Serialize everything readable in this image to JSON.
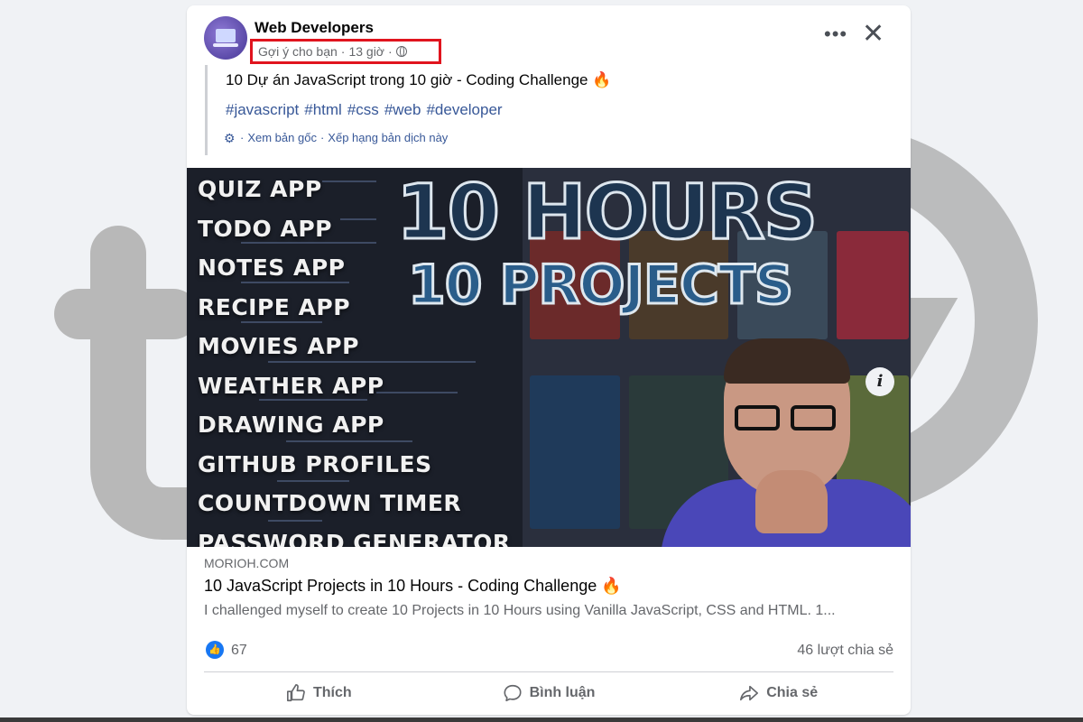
{
  "post": {
    "page_name": "Web Developers",
    "suggested": "Gợi ý cho bạn",
    "sep1": "·",
    "time": "13 giờ",
    "sep2": "·",
    "text": "10 Dự án JavaScript trong 10 giờ - Coding Challenge 🔥",
    "hashtags": [
      "#javascript",
      "#html",
      "#css",
      "#web",
      "#developer"
    ],
    "translate_sep": "·",
    "see_original": "Xem bản gốc",
    "sep3": "·",
    "rate_translation": "Xếp hạng bản dịch này"
  },
  "thumbnail": {
    "apps": [
      "QUIZ APP",
      "TODO APP",
      "NOTES APP",
      "RECIPE APP",
      "MOVIES APP",
      "WEATHER APP",
      "DRAWING APP",
      "GITHUB PROFILES",
      "COUNTDOWN TIMER",
      "PASSWORD GENERATOR"
    ],
    "headline_1": "10 HOURS",
    "headline_2": "10 PROJECTS"
  },
  "link": {
    "domain": "MORIOH.COM",
    "title": "10 JavaScript Projects in 10 Hours - Coding Challenge 🔥",
    "description": "I challenged myself to create 10 Projects in 10 Hours using Vanilla JavaScript, CSS and HTML. 1..."
  },
  "stats": {
    "likes": "67",
    "shares": "46 lượt chia sẻ"
  },
  "actions": {
    "like": "Thích",
    "comment": "Bình luận",
    "share": "Chia sẻ"
  },
  "icons": {
    "more": "more-dots-icon",
    "close": "close-icon",
    "globe": "globe-icon",
    "gear": "gear-icon",
    "info": "info-icon",
    "like_reaction": "thumbs-up-icon",
    "like": "thumbs-up-outline-icon",
    "comment": "comment-bubble-icon",
    "share": "share-arrow-icon"
  },
  "colors": {
    "link_blue": "#385898",
    "reaction_blue": "#1877f2",
    "highlight_red": "#e0141e",
    "muted_text": "#65676b"
  }
}
